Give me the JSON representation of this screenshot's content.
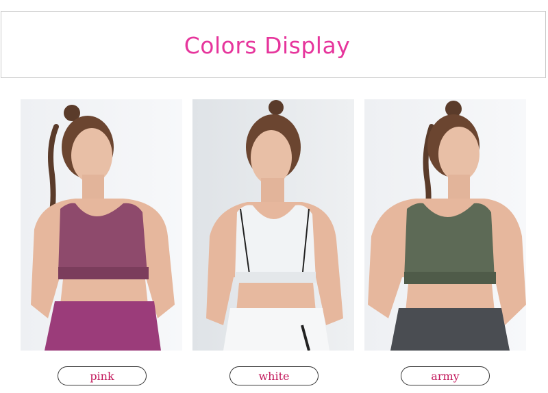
{
  "header": {
    "title": "Colors Display"
  },
  "colors": {
    "accent": "#e6359c",
    "label_text": "#c2185b",
    "pink_top": "#8e4a6c",
    "white_top": "#f1f3f5",
    "army_top": "#5d6a56"
  },
  "variants": [
    {
      "label": "pink"
    },
    {
      "label": "white"
    },
    {
      "label": "army"
    }
  ]
}
